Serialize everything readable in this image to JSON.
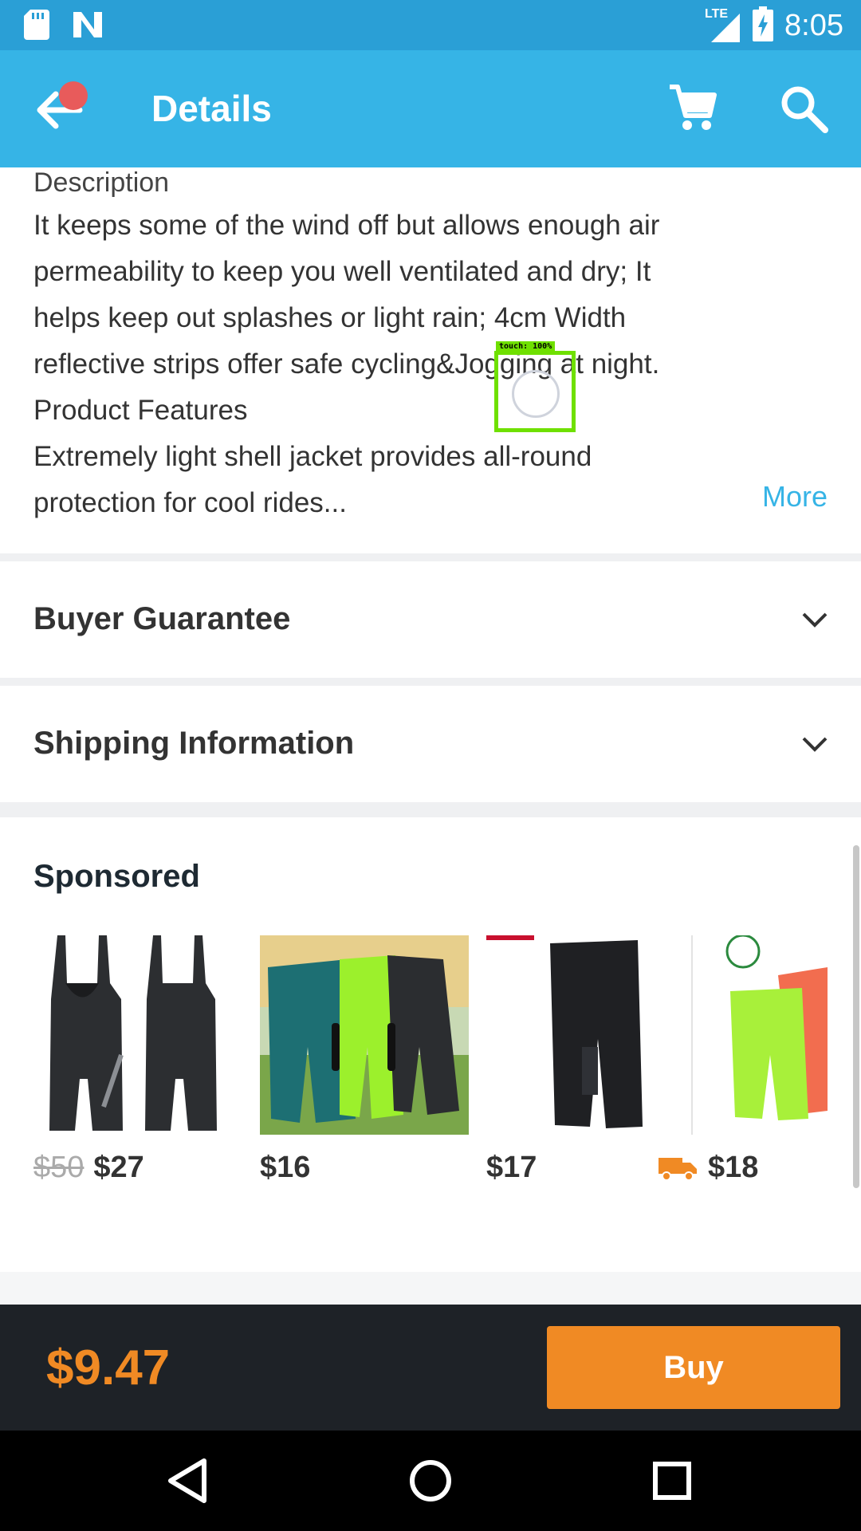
{
  "status_bar": {
    "time": "8:05",
    "network": "LTE",
    "icons": [
      "sd-card-icon",
      "n-app-icon",
      "signal-icon",
      "battery-charging-icon"
    ]
  },
  "app_bar": {
    "title": "Details",
    "icons": [
      "back-arrow-icon",
      "cart-icon",
      "search-icon"
    ]
  },
  "description": {
    "heading": "Description",
    "lines": [
      "It keeps some of the wind off but allows enough air",
      "permeability to keep you well ventilated and dry; It",
      "helps keep out splashes or light rain; 4cm Width",
      "reflective strips offer safe cycling&Jogging at night.",
      "Product Features",
      "Extremely light shell jacket provides all-round",
      "protection for cool rides..."
    ],
    "more_label": "More"
  },
  "touch_overlay": {
    "label": "touch: 100%"
  },
  "accordions": [
    {
      "title": "Buyer Guarantee"
    },
    {
      "title": "Shipping Information"
    }
  ],
  "sponsored": {
    "title": "Sponsored",
    "items": [
      {
        "old_price": "$50",
        "price": "$27",
        "image": "black cycling bib shorts"
      },
      {
        "old_price": "",
        "price": "$16",
        "image": "teal, green and black cycling shorts"
      },
      {
        "old_price": "",
        "price": "$17",
        "image": "black cycling shorts"
      },
      {
        "old_price": "",
        "price": "$18",
        "image": "green and orange cycling shorts",
        "badge": "shipping-truck-icon"
      }
    ]
  },
  "bottom_bar": {
    "price": "$9.47",
    "buy_label": "Buy"
  },
  "colors": {
    "status_bar": "#2a9fd6",
    "app_bar": "#36b4e6",
    "accent_orange": "#f08a24",
    "bottom_bar": "#1e2227",
    "link": "#36b4e6"
  }
}
